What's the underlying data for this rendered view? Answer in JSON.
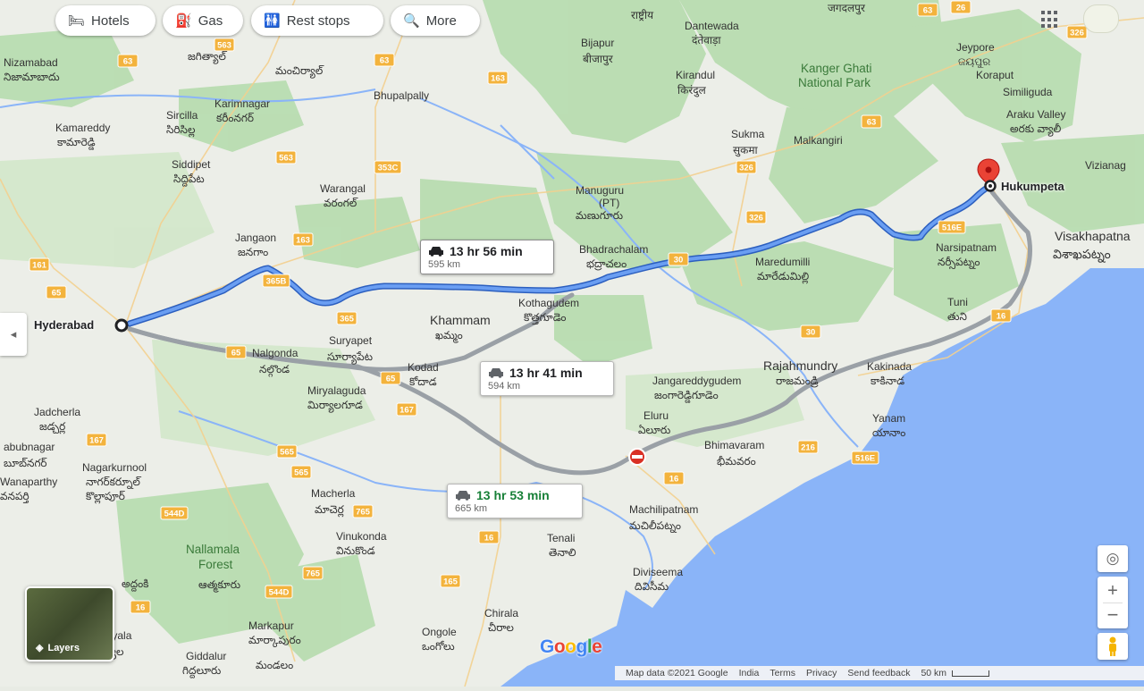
{
  "toolbar": {
    "hotels": "Hotels",
    "gas": "Gas",
    "rest_stops": "Rest stops",
    "more": "More"
  },
  "route": {
    "origin": "Hyderabad",
    "destination": "Hukumpeta",
    "options": [
      {
        "time": "13 hr 56 min",
        "distance": "595 km",
        "selected": true
      },
      {
        "time": "13 hr 41 min",
        "distance": "594 km",
        "selected": false
      },
      {
        "time": "13 hr 53 min",
        "distance": "665 km",
        "selected": false,
        "best": true
      }
    ]
  },
  "places": {
    "nizamabad": "Nizamabad",
    "nizamabad_te": "నిజామాబాదు",
    "bijapur": "Bijapur",
    "bijapur_te": "बीजापुर",
    "jeypore": "Jeypore",
    "jeypore_te": "ଜୟପୁର",
    "kanger": "Kanger Ghati",
    "kanger2": "National Park",
    "karimnagar": "Karimnagar",
    "karimnagar_te": "కరీంనగర్",
    "kamareddy": "Kamareddy",
    "kamareddy_te": "కామారెడ్డి",
    "sircilla": "Sircilla",
    "sircilla_te": "సిరిసిల్ల",
    "bhupalpally": "Bhupalpally",
    "sukma": "Sukma",
    "sukma_te": "सुकमा",
    "malkangiri": "Malkangiri",
    "siddipet": "Siddipet",
    "siddipet_te": "సిద్దిపేట",
    "warangal": "Warangal",
    "warangal_te": "వరంగల్",
    "manuguru": "Manuguru",
    "manuguru2": "(PT)",
    "manuguru_te": "మణుగూరు",
    "araku": "Araku Valley",
    "araku_te": "అరకు వ్యాలీ",
    "similiguda": "Similiguda",
    "koraput": "Koraput",
    "vizianagaram": "Vizianag",
    "jangaon": "Jangaon",
    "jangaon_te": "జనగాం",
    "bhadrachalam": "Bhadrachalam",
    "bhadrachalam_te": "భద్రాచలం",
    "maredumilli": "Maredumilli",
    "maredumilli_te": "మారేడుమిల్లి",
    "narsipatnam": "Narsipatnam",
    "narsipatnam_te": "నర్సీపట్నం",
    "visakhapatnam": "Visakhapatna",
    "visakhapatnam_te": "విశాఖపట్నం",
    "khammam": "Khammam",
    "khammam_te": "ఖమ్మం",
    "kothagudem": "Kothagudem",
    "kothagudem_te": "కొత్తగూడెం",
    "tuni": "Tuni",
    "tuni_te": "తుని",
    "suryapet": "Suryapet",
    "suryapet_te": "సూర్యాపేట",
    "nalgonda": "Nalgonda",
    "nalgonda_te": "నల్గొండ",
    "kodad": "Kodad",
    "kodad_te": "కోదాడ",
    "rajahmundry": "Rajahmundry",
    "rajahmundry_te": "రాజమండ్రి",
    "kakinada": "Kakinada",
    "kakinada_te": "కాకినాడ",
    "miryalaguda": "Miryalaguda",
    "miryalaguda_te": "మిర్యాలగూడ",
    "jangareddy": "Jangareddygudem",
    "jangareddy_te": "జంగారెడ్డిగూడెం",
    "jadcherla": "Jadcherla",
    "jadcherla_te": "జడ్చర్ల",
    "eluru": "Eluru",
    "eluru_te": "ఏలూరు",
    "yanam": "Yanam",
    "yanam_te": "యానాం",
    "mahbubnagar": "abubnagar",
    "mahbubnagar_te": "బూబ్‌నగర్",
    "bhimavaram": "Bhimavaram",
    "bhimavaram_te": "భీమవరం",
    "nagarkurnool": "Nagarkurnool",
    "nagarkurnool_te": "నాగర్‌కర్నూల్",
    "wanaparthy": "Wanaparthy",
    "wanaparthy_te": "వనపర్తి",
    "kollapur": "కొల్లాపూర్",
    "macherla": "Macherla",
    "macherla_te": "మాచెర్ల",
    "machilipatnam": "Machilipatnam",
    "machilipatnam_te": "మచిలీపట్నం",
    "nallamala": "Nallamala",
    "nallamala2": "Forest",
    "vinukonda": "Vinukonda",
    "vinukonda_te": "వినుకొండ",
    "tenali": "Tenali",
    "tenali_te": "తెనాలి",
    "diviseema": "Diviseema",
    "diviseema_te": "దివిసీమ",
    "atmakur": "ఆత్మకూరు",
    "addanki": "అద్దంకి",
    "chirala": "Chirala",
    "chirala_te": "చీరాల",
    "markapur": "Markapur",
    "markapur_te": "మార్కాపురం",
    "ongole": "Ongole",
    "ongole_te": "ఒంగోలు",
    "giddalur": "Giddalur",
    "giddalur_te": "గిద్దలూరు",
    "mandalam": "మండలం",
    "nandyala": "ndyala",
    "nandyala_te": "ద్యాల",
    "kirandul": "Kirandul",
    "kirandul_te": "किरंदुल",
    "dantewada": "Dantewada",
    "dantewada_te": "दंतेवाड़ा",
    "mancherial": "మంచిర్యాల్",
    "jagtial": "జగిత్యాల్",
    "jagdalpur": "जगदलपुर",
    "national": "राष्ट्रीय"
  },
  "highways": [
    "63",
    "563",
    "63",
    "163",
    "563",
    "353C",
    "163",
    "161",
    "65",
    "365B",
    "365",
    "65",
    "65",
    "167",
    "167",
    "565",
    "565",
    "765",
    "544D",
    "765",
    "544D",
    "16",
    "16",
    "165",
    "16",
    "216",
    "516E",
    "516E",
    "30",
    "30",
    "326",
    "326",
    "63",
    "26",
    "326",
    "63",
    "16"
  ],
  "layers_label": "Layers",
  "google_logo": "Google",
  "footer": {
    "map_data": "Map data ©2021 Google",
    "india": "India",
    "terms": "Terms",
    "privacy": "Privacy",
    "feedback": "Send feedback",
    "scale": "50 km"
  },
  "colors": {
    "route_primary": "#4a86e8",
    "route_alt": "#9aa0a6",
    "sea": "#8ab4f8",
    "land": "#eef0ea",
    "forest": "#a8d5a2",
    "pin": "#ea4335"
  }
}
